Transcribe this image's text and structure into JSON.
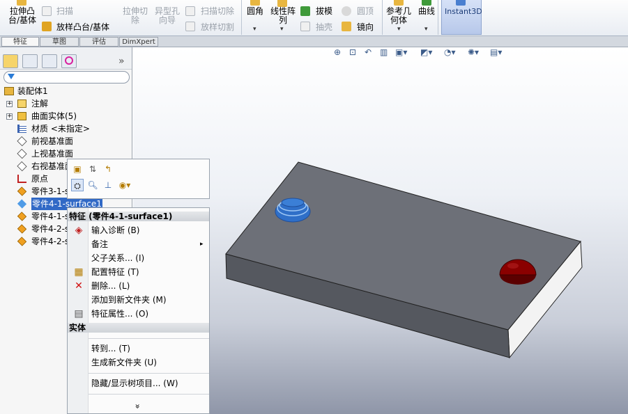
{
  "ribbon": {
    "extrude_boss": [
      "拉伸凸",
      "台/基体"
    ],
    "sweep": "扫描",
    "loft_boss": "放样凸台/基体",
    "extrude_cut": [
      "拉伸切",
      "除"
    ],
    "hole_wizard": [
      "异型孔",
      "向导"
    ],
    "sweep_cut": "扫描切除",
    "loft_cut": "放样切割",
    "fillet": "圆角",
    "linear_pattern": [
      "线性阵",
      "列"
    ],
    "draft": "拔模",
    "dome": "圆顶",
    "shell": "抽壳",
    "mirror": "镜向",
    "ref_geometry": [
      "参考几",
      "何体"
    ],
    "curves": "曲线",
    "instant3d": "Instant3D"
  },
  "tabs": [
    "特征",
    "草图",
    "评估",
    "DimXpert"
  ],
  "tree": {
    "more_glyph": "»",
    "root": "装配体1",
    "items": [
      {
        "label": "注解",
        "expander": "+"
      },
      {
        "label": "曲面实体(5)",
        "expander": "+"
      },
      {
        "label": "材质 <未指定>",
        "expander": ""
      },
      {
        "label": "前视基准面",
        "expander": ""
      },
      {
        "label": "上视基准面",
        "expander": ""
      },
      {
        "label": "右视基准面",
        "expander": ""
      },
      {
        "label": "原点",
        "expander": ""
      },
      {
        "label": "零件3-1-s",
        "expander": ""
      },
      {
        "label": "零件4-1-surface1",
        "expander": ""
      },
      {
        "label": "零件4-1-s",
        "expander": ""
      },
      {
        "label": "零件4-2-s",
        "expander": ""
      },
      {
        "label": "零件4-2-s",
        "expander": ""
      }
    ]
  },
  "context_menu": {
    "header_feature": "特征  (零件4-1-surface1)",
    "items_feature": [
      {
        "label": "输入诊断  (B)",
        "icon": "diagnose-icon"
      },
      {
        "label": "备注",
        "icon": "",
        "submenu": true
      },
      {
        "label": "父子关系...  (I)",
        "icon": ""
      },
      {
        "label": "配置特征  (T)",
        "icon": "configure-icon"
      },
      {
        "label": "删除...  (L)",
        "icon": "delete-icon"
      },
      {
        "label": "添加到新文件夹  (M)",
        "icon": ""
      },
      {
        "label": "特征属性...  (O)",
        "icon": "properties-icon"
      }
    ],
    "header_body": "实体",
    "items_body": [
      {
        "label": "转到...  (T)"
      },
      {
        "label": "生成新文件夹  (U)"
      },
      {
        "label": "隐藏/显示树项目...  (W)"
      }
    ],
    "submenu_arrow": "▸",
    "more_arrow": "»"
  },
  "colors": {
    "plate_top": "#6b6e76",
    "plate_front": "#55585f",
    "plate_side": "#f2f2f2",
    "hole": "#3b7fd6",
    "dome": "#8a0000",
    "selection": "#3169c6"
  }
}
